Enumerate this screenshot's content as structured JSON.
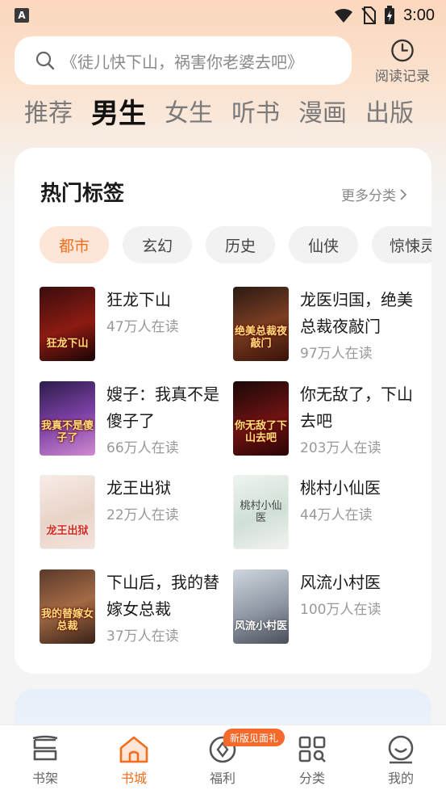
{
  "status_bar": {
    "time": "3:00",
    "app_badge": "A"
  },
  "search": {
    "placeholder": "《徒儿快下山，祸害你老婆去吧》"
  },
  "history": {
    "label": "阅读记录"
  },
  "tabs": [
    {
      "label": "推荐",
      "active": false
    },
    {
      "label": "男生",
      "active": true
    },
    {
      "label": "女生",
      "active": false
    },
    {
      "label": "听书",
      "active": false
    },
    {
      "label": "漫画",
      "active": false
    },
    {
      "label": "出版",
      "active": false
    }
  ],
  "hot_tags": {
    "title": "热门标签",
    "more_label": "更多分类",
    "chips": [
      {
        "label": "都市",
        "active": true
      },
      {
        "label": "玄幻",
        "active": false
      },
      {
        "label": "历史",
        "active": false
      },
      {
        "label": "仙侠",
        "active": false
      },
      {
        "label": "惊悚灵",
        "active": false
      }
    ],
    "books": [
      {
        "title": "狂龙下山",
        "readers": "47万人在读",
        "cover_text": "狂龙下山"
      },
      {
        "title": "龙医归国，绝美总裁夜敲门",
        "readers": "97万人在读",
        "cover_text": "绝美总裁夜敲门"
      },
      {
        "title": "嫂子：我真不是傻子了",
        "readers": "66万人在读",
        "cover_text": "我真不是傻子了"
      },
      {
        "title": "你无敌了，下山去吧",
        "readers": "203万人在读",
        "cover_text": "你无敌了下山去吧"
      },
      {
        "title": "龙王出狱",
        "readers": "22万人在读",
        "cover_text": "龙王出狱"
      },
      {
        "title": "桃村小仙医",
        "readers": "44万人在读",
        "cover_text": "桃村小仙医"
      },
      {
        "title": "下山后，我的替嫁女总裁",
        "readers": "37万人在读",
        "cover_text": "我的替嫁女总裁"
      },
      {
        "title": "风流小村医",
        "readers": "100万人在读",
        "cover_text": "风流小村医"
      }
    ]
  },
  "bottom_nav": {
    "promo_badge": "新版见面礼",
    "items": [
      {
        "label": "书架",
        "icon": "bookshelf-icon",
        "active": false
      },
      {
        "label": "书城",
        "icon": "home-icon",
        "active": true
      },
      {
        "label": "福利",
        "icon": "coin-icon",
        "active": false
      },
      {
        "label": "分类",
        "icon": "category-grid-icon",
        "active": false
      },
      {
        "label": "我的",
        "icon": "profile-icon",
        "active": false
      }
    ]
  },
  "colors": {
    "accent": "#f26d1c",
    "chip_active_bg": "#fde6d8"
  }
}
